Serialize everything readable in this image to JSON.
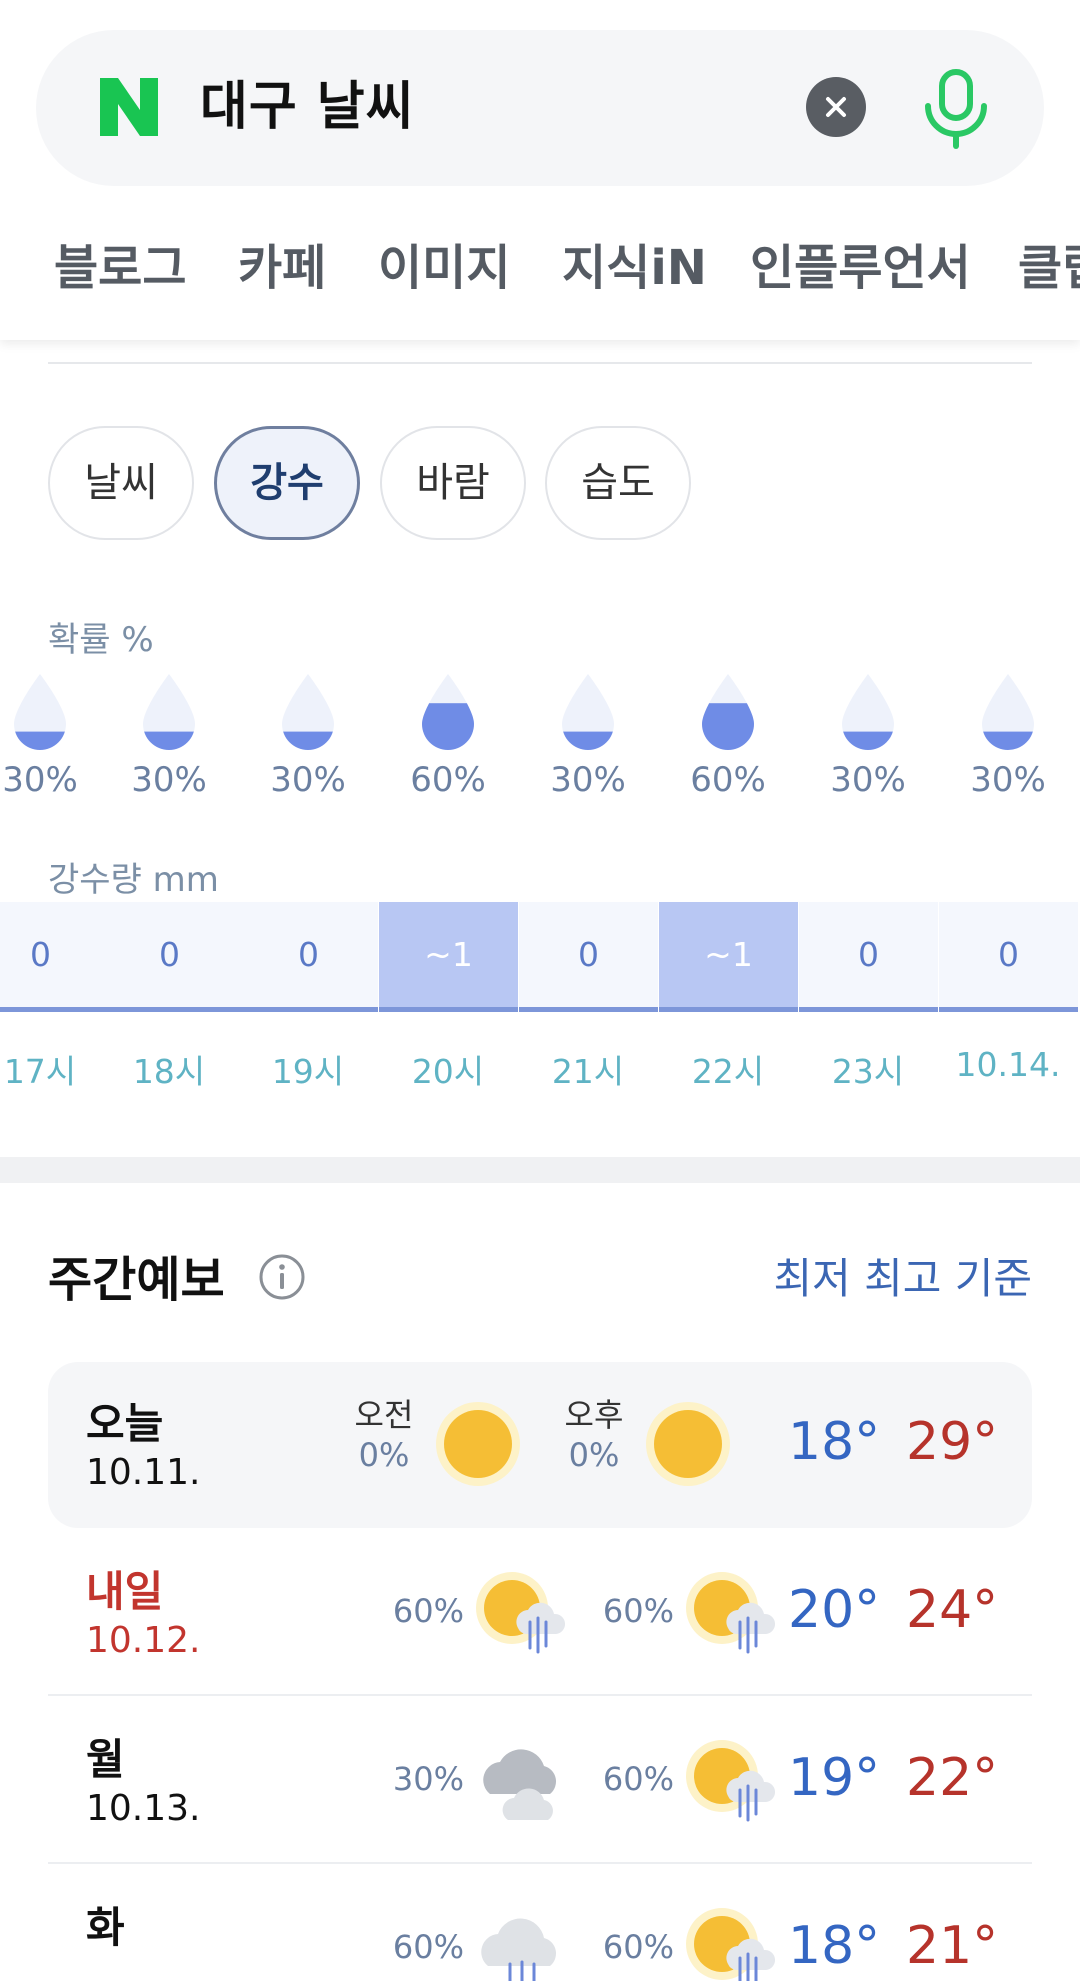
{
  "search": {
    "query": "대구 날씨",
    "logo_letter": "N"
  },
  "tabs": [
    "블로그",
    "카페",
    "이미지",
    "지식iN",
    "인플루언서",
    "클립"
  ],
  "chips": [
    "날씨",
    "강수",
    "바람",
    "습도"
  ],
  "precip": {
    "prob_label": "확률 %",
    "amount_label": "강수량 mm",
    "hours": [
      {
        "hour": "17시",
        "prob": "30%",
        "prob_value": 30,
        "amount": "0",
        "highlight": false
      },
      {
        "hour": "18시",
        "prob": "30%",
        "prob_value": 30,
        "amount": "0",
        "highlight": false
      },
      {
        "hour": "19시",
        "prob": "30%",
        "prob_value": 30,
        "amount": "0",
        "highlight": false
      },
      {
        "hour": "20시",
        "prob": "60%",
        "prob_value": 60,
        "amount": "~1",
        "highlight": true
      },
      {
        "hour": "21시",
        "prob": "30%",
        "prob_value": 30,
        "amount": "0",
        "highlight": false
      },
      {
        "hour": "22시",
        "prob": "60%",
        "prob_value": 60,
        "amount": "~1",
        "highlight": true
      },
      {
        "hour": "23시",
        "prob": "30%",
        "prob_value": 30,
        "amount": "0",
        "highlight": false
      },
      {
        "hour": "10.14.",
        "prob": "30%",
        "prob_value": 30,
        "amount": "0",
        "highlight": false
      }
    ]
  },
  "weekly": {
    "title": "주간예보",
    "basis_link": "최저 최고 기준",
    "days": [
      {
        "day": "오늘",
        "date": "10.11.",
        "am_label": "오전",
        "pm_label": "오후",
        "am_pct": "0%",
        "pm_pct": "0%",
        "am_icon": "sun-icon",
        "pm_icon": "sun-icon",
        "min": "18°",
        "max": "29°",
        "holiday": false
      },
      {
        "day": "내일",
        "date": "10.12.",
        "am_pct": "60%",
        "pm_pct": "60%",
        "am_icon": "sun-cloud-rain-icon",
        "pm_icon": "sun-cloud-rain-icon",
        "min": "20°",
        "max": "24°",
        "holiday": true
      },
      {
        "day": "월",
        "date": "10.13.",
        "am_pct": "30%",
        "pm_pct": "60%",
        "am_icon": "cloudy-icon",
        "pm_icon": "sun-cloud-rain-icon",
        "min": "19°",
        "max": "22°",
        "holiday": false
      },
      {
        "day": "화",
        "date": "",
        "am_pct": "60%",
        "pm_pct": "60%",
        "am_icon": "cloud-rain-icon",
        "pm_icon": "sun-cloud-rain-icon",
        "min": "18°",
        "max": "21°",
        "holiday": false
      }
    ]
  },
  "colors": {
    "accent_green": "#03c75a",
    "min_temp": "#3466c2",
    "max_temp": "#b6332b",
    "drop_fill": "#6f8ce6"
  }
}
